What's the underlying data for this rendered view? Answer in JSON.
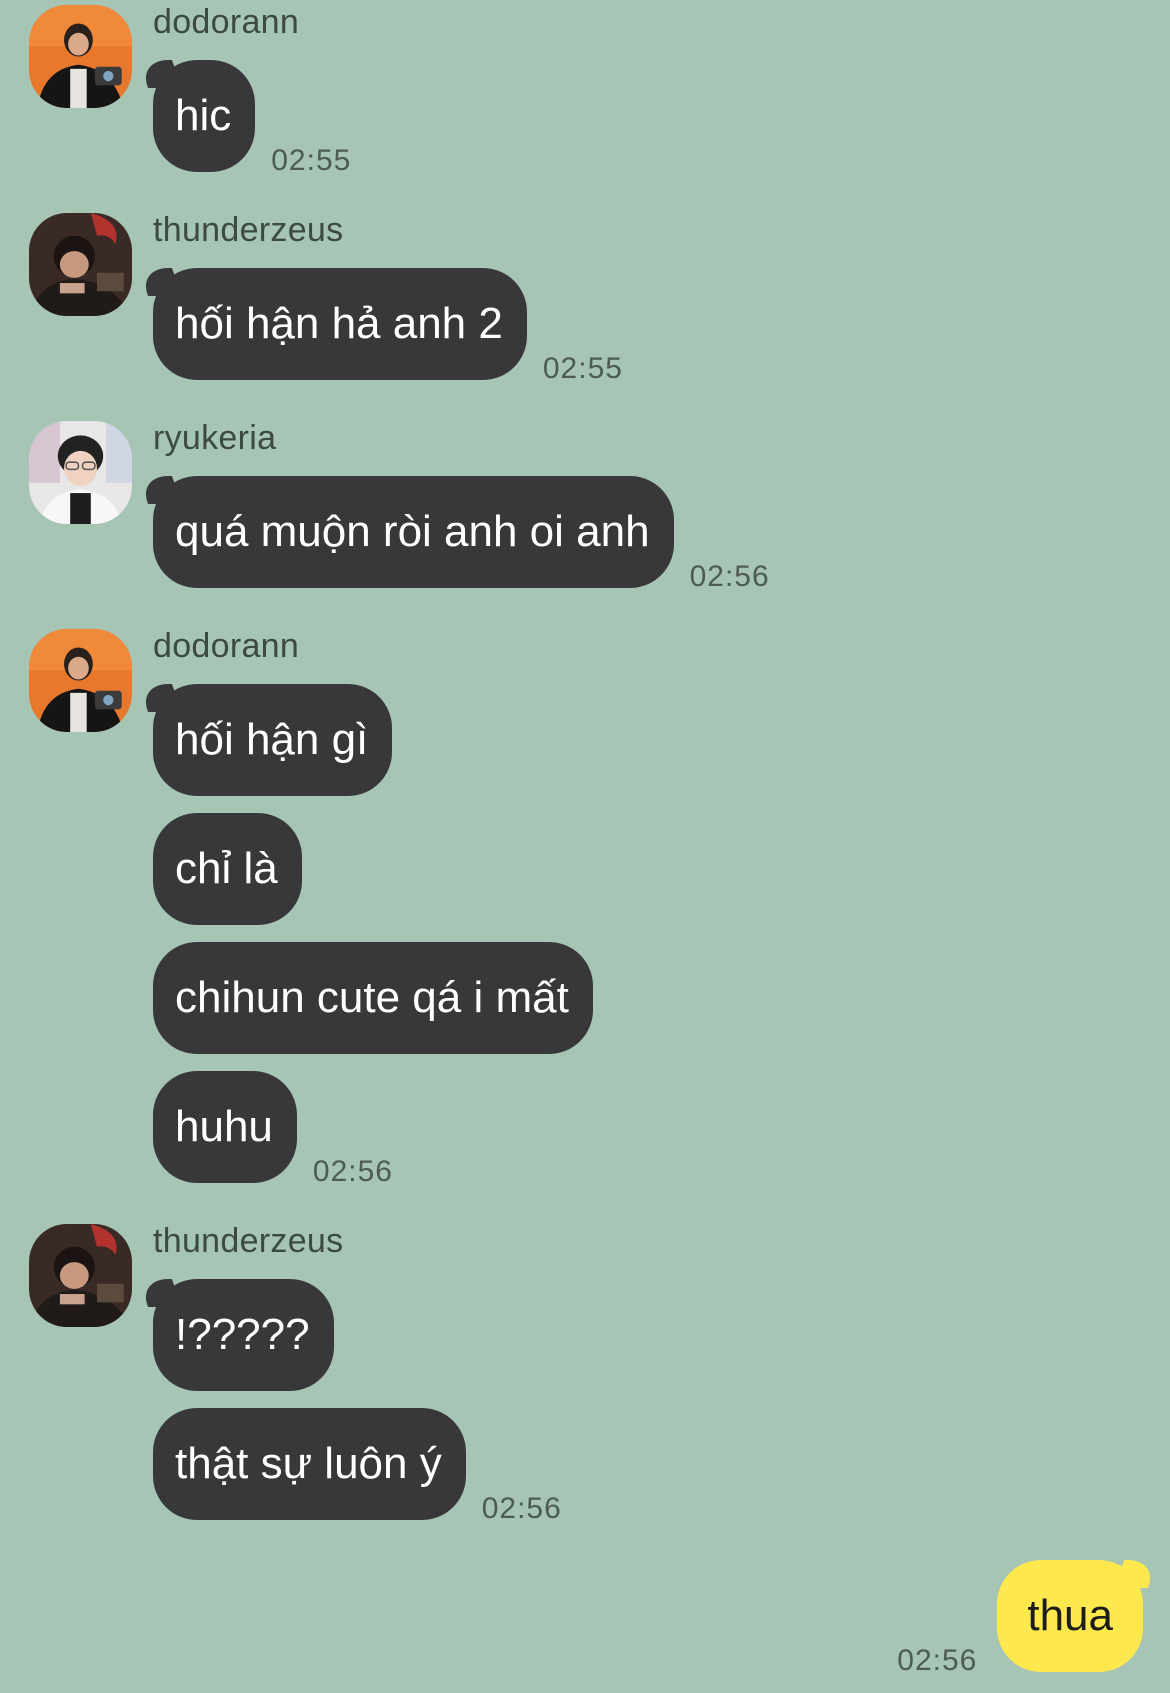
{
  "chat": {
    "groups": [
      {
        "sender": "dodorann",
        "avatar": "profile-photo-dodorann",
        "messages": [
          "hic"
        ],
        "time": "02:55"
      },
      {
        "sender": "thunderzeus",
        "avatar": "profile-photo-thunderzeus",
        "messages": [
          "hối hận hả anh 2"
        ],
        "time": "02:55"
      },
      {
        "sender": "ryukeria",
        "avatar": "profile-photo-ryukeria",
        "messages": [
          "quá muộn ròi anh oi anh"
        ],
        "time": "02:56"
      },
      {
        "sender": "dodorann",
        "avatar": "profile-photo-dodorann",
        "messages": [
          "hối hận gì",
          "chỉ là",
          "chihun cute qá i mất",
          "huhu"
        ],
        "time": "02:56"
      },
      {
        "sender": "thunderzeus",
        "avatar": "profile-photo-thunderzeus",
        "messages": [
          "!?????",
          "thật sự luôn ý"
        ],
        "time": "02:56"
      }
    ],
    "mine": {
      "message": "thua",
      "time": "02:56"
    }
  },
  "colors": {
    "background": "#a6c5b5",
    "incoming_bubble": "#38383b",
    "outgoing_bubble": "#fde84d"
  }
}
